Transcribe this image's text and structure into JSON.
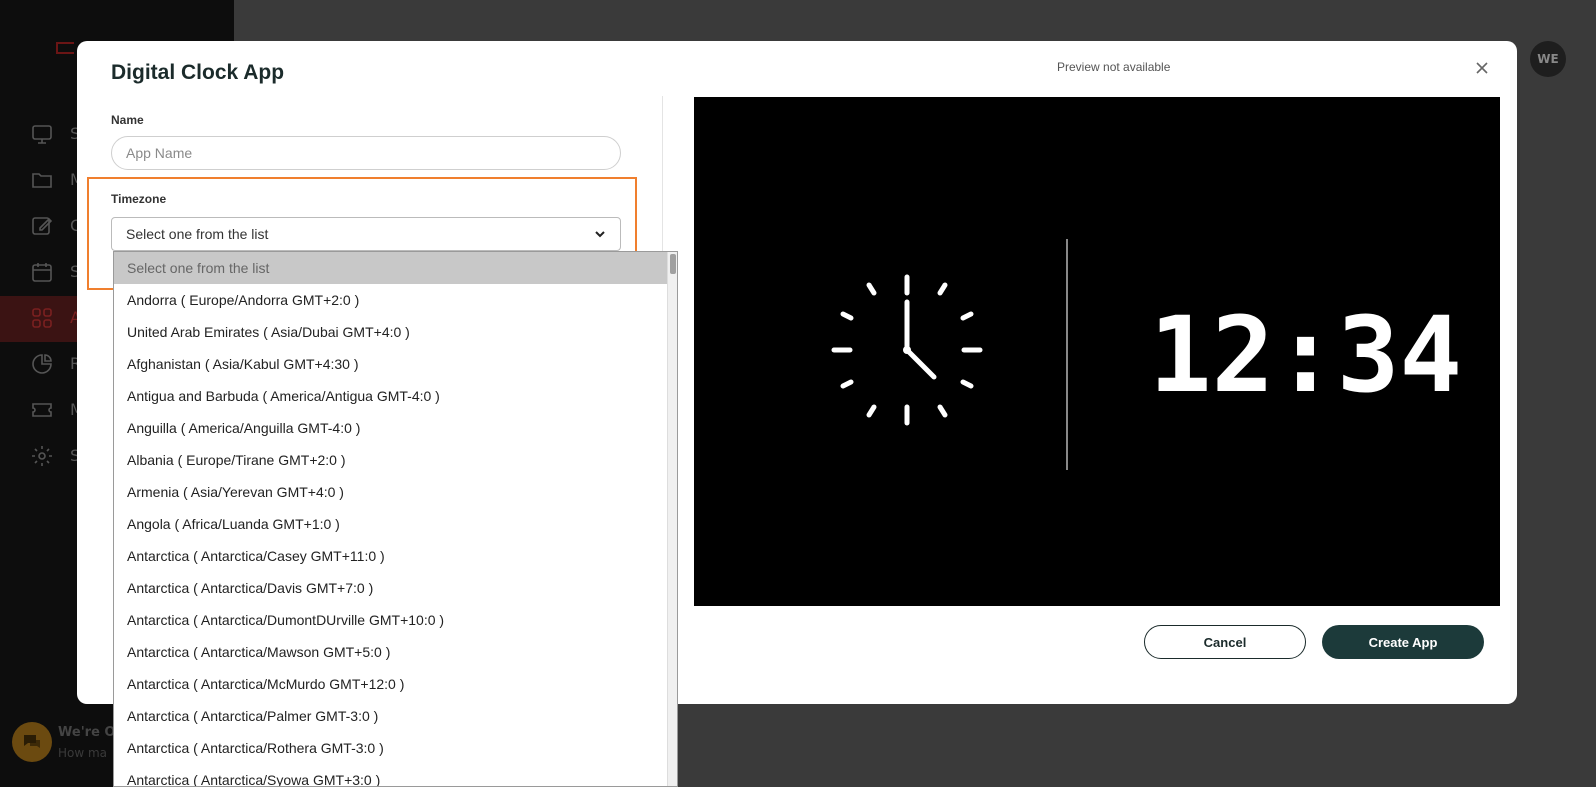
{
  "background": {
    "nav_letters": [
      "S",
      "M",
      "C",
      "S",
      "A",
      "R",
      "M",
      "S"
    ],
    "avatar_initials": "WE",
    "chat_title": "We're On",
    "chat_subtitle": "How ma"
  },
  "modal": {
    "title": "Digital Clock App",
    "preview_note": "Preview not available",
    "name_label": "Name",
    "name_placeholder": "App Name",
    "name_value": "",
    "timezone_label": "Timezone",
    "timezone_selected": "Select one from the list",
    "cancel_label": "Cancel",
    "create_label": "Create App",
    "preview_digital_time": "12:34",
    "accent_color": "#f07f2e",
    "primary_button_color": "#1c3a3a"
  },
  "timezone_options": [
    "Select one from the list",
    "Andorra ( Europe/Andorra GMT+2:0 )",
    "United Arab Emirates ( Asia/Dubai GMT+4:0 )",
    "Afghanistan ( Asia/Kabul GMT+4:30 )",
    "Antigua and Barbuda ( America/Antigua GMT-4:0 )",
    "Anguilla ( America/Anguilla GMT-4:0 )",
    "Albania ( Europe/Tirane GMT+2:0 )",
    "Armenia ( Asia/Yerevan GMT+4:0 )",
    "Angola ( Africa/Luanda GMT+1:0 )",
    "Antarctica ( Antarctica/Casey GMT+11:0 )",
    "Antarctica ( Antarctica/Davis GMT+7:0 )",
    "Antarctica ( Antarctica/DumontDUrville GMT+10:0 )",
    "Antarctica ( Antarctica/Mawson GMT+5:0 )",
    "Antarctica ( Antarctica/McMurdo GMT+12:0 )",
    "Antarctica ( Antarctica/Palmer GMT-3:0 )",
    "Antarctica ( Antarctica/Rothera GMT-3:0 )",
    "Antarctica ( Antarctica/Syowa GMT+3:0 )"
  ]
}
